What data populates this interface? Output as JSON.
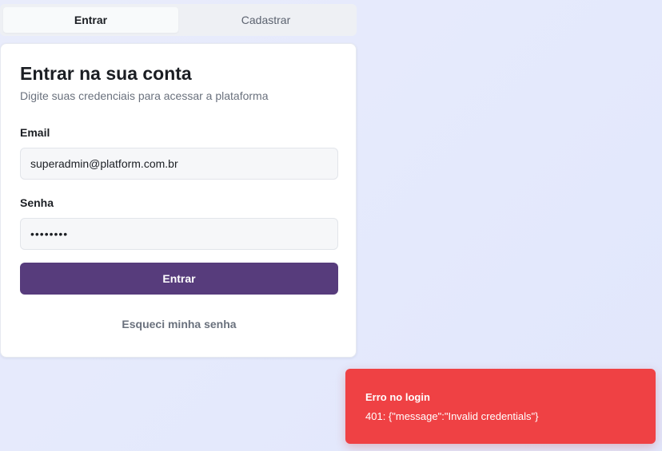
{
  "tabs": [
    {
      "label": "Entrar",
      "active": true
    },
    {
      "label": "Cadastrar",
      "active": false
    }
  ],
  "card": {
    "title": "Entrar na sua conta",
    "subtitle": "Digite suas credenciais para acessar a plataforma",
    "email_label": "Email",
    "email_value": "superadmin@platform.com.br",
    "password_label": "Senha",
    "password_value": "••••••••",
    "submit_label": "Entrar",
    "forgot_label": "Esqueci minha senha"
  },
  "toast": {
    "title": "Erro no login",
    "message": "401: {\"message\":\"Invalid credentials\"}"
  },
  "colors": {
    "primary_button": "#573c7c",
    "toast_background": "#ef4144",
    "page_background": "#e4e9fc"
  }
}
